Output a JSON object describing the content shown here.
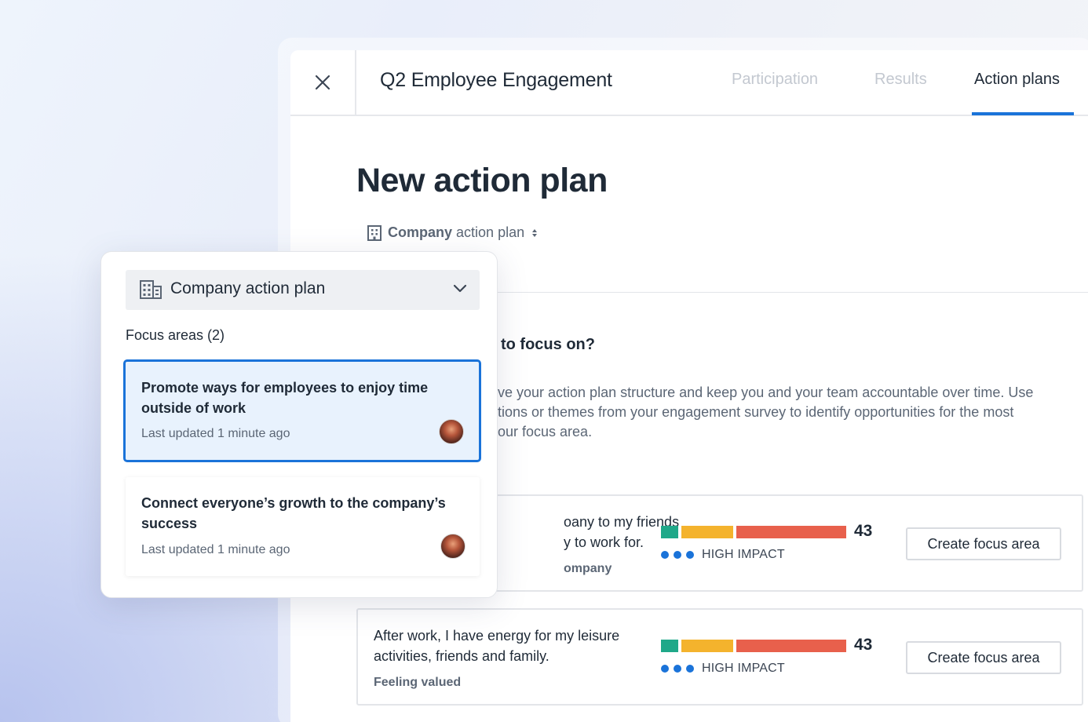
{
  "header": {
    "close_icon": "close-icon",
    "survey_title": "Q2 Employee Engagement",
    "tabs": [
      {
        "label": "Participation",
        "active": false
      },
      {
        "label": "Results",
        "active": false
      },
      {
        "label": "Action plans",
        "active": true
      }
    ]
  },
  "main": {
    "page_title": "New action plan",
    "plan_selector": {
      "bold": "Company",
      "rest": "action plan",
      "icon": "building-icon"
    },
    "section_question": "to focus on?",
    "section_description": "ve your action plan structure and keep you and your team accountable over time. Use\ntions or themes from your engagement survey to identify opportunities for the most\nour focus area.",
    "questions": [
      {
        "text": "oany to my friends\ny to work for.",
        "category": "ompany",
        "score": "43",
        "impact": "HIGH IMPACT",
        "button": "Create focus area"
      },
      {
        "text": "After work, I have energy for my leisure activities, friends and family.",
        "category": "Feeling valued",
        "score": "43",
        "impact": "HIGH IMPACT",
        "button": "Create focus area"
      }
    ]
  },
  "popup": {
    "select_label": "Company action plan",
    "select_icon": "building-icon",
    "focus_heading": "Focus areas (2)",
    "focus_areas": [
      {
        "title": "Promote ways for employees to enjoy time outside of work",
        "updated": "Last updated 1 minute ago",
        "selected": true
      },
      {
        "title": "Connect everyone’s growth to the company’s success",
        "updated": "Last updated 1 minute ago",
        "selected": false
      }
    ]
  },
  "colors": {
    "accent": "#1a73d9",
    "bar_green": "#1fa889",
    "bar_yellow": "#f4b32d",
    "bar_red": "#e8604c"
  }
}
